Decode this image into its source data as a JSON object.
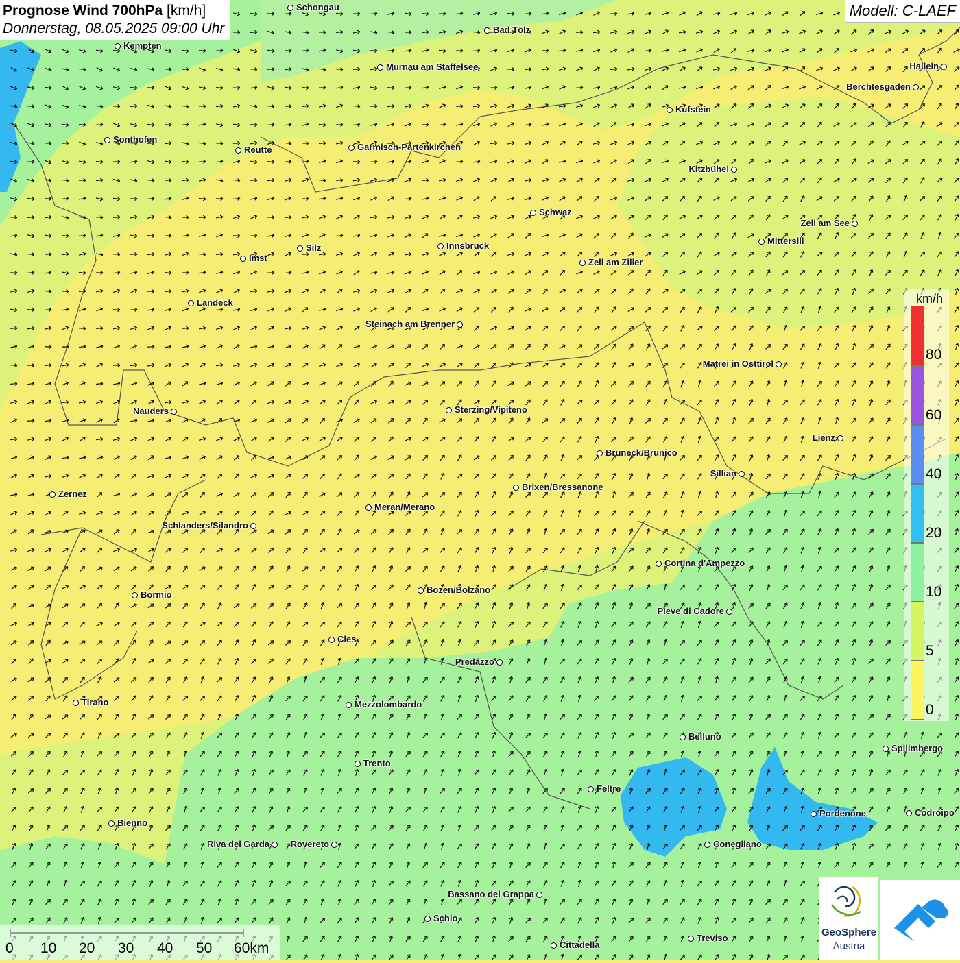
{
  "title": {
    "bold": "Prognose Wind 700hPa",
    "unit": "[km/h]",
    "date": "Donnerstag, 08.05.2025 09:00 Uhr"
  },
  "model": "Modell: C-LAEF",
  "legend": {
    "unit": "km/h",
    "labels": [
      "80",
      "60",
      "40",
      "20",
      "10",
      "5",
      "0"
    ],
    "bands": [
      {
        "range": "80+",
        "color": "#f03030"
      },
      {
        "range": "60-80",
        "color": "#9a55e0"
      },
      {
        "range": "40-60",
        "color": "#5a8ef0"
      },
      {
        "range": "20-40",
        "color": "#33c0f0"
      },
      {
        "range": "10-20",
        "color": "#8ef0a0"
      },
      {
        "range": "5-10",
        "color": "#d4f560"
      },
      {
        "range": "0-5",
        "color": "#fdf560"
      }
    ]
  },
  "scale_bar": {
    "labels": [
      "0",
      "10",
      "20",
      "30",
      "40",
      "50",
      "60km"
    ]
  },
  "logo": {
    "name1": "GeoSphere",
    "name2": "Austria"
  },
  "cities": [
    {
      "name": "Schongau"
    },
    {
      "name": "Bad Tölz"
    },
    {
      "name": "Kempten"
    },
    {
      "name": "Murnau am Staffelsee"
    },
    {
      "name": "Hallein"
    },
    {
      "name": "Berchtesgaden"
    },
    {
      "name": "Kufstein"
    },
    {
      "name": "Sonthofen"
    },
    {
      "name": "Reutte"
    },
    {
      "name": "Garmisch-Partenkirchen"
    },
    {
      "name": "Kitzbühel"
    },
    {
      "name": "Schwaz"
    },
    {
      "name": "Zell am See"
    },
    {
      "name": "Mittersill"
    },
    {
      "name": "Silz"
    },
    {
      "name": "Innsbruck"
    },
    {
      "name": "Imst"
    },
    {
      "name": "Zell am Ziller"
    },
    {
      "name": "Landeck"
    },
    {
      "name": "Steinach am Brenner"
    },
    {
      "name": "Matrei in Osttirol"
    },
    {
      "name": "Nauders"
    },
    {
      "name": "Sterzing/Vipiteno"
    },
    {
      "name": "Lienz"
    },
    {
      "name": "Bruneck/Brunico"
    },
    {
      "name": "Sillian"
    },
    {
      "name": "Zernez"
    },
    {
      "name": "Brixen/Bressanone"
    },
    {
      "name": "Meran/Merano"
    },
    {
      "name": "Schlanders/Silandro"
    },
    {
      "name": "Cortina d'Ampezzo"
    },
    {
      "name": "Bozen/Bolzano"
    },
    {
      "name": "Bormio"
    },
    {
      "name": "Pieve di Cadore"
    },
    {
      "name": "Cles"
    },
    {
      "name": "Predazzo"
    },
    {
      "name": "Tirano"
    },
    {
      "name": "Mezzolombardo"
    },
    {
      "name": "Belluno"
    },
    {
      "name": "Spilimbergo"
    },
    {
      "name": "Trento"
    },
    {
      "name": "Feltre"
    },
    {
      "name": "Bienno"
    },
    {
      "name": "Pordenone"
    },
    {
      "name": "Codroipo"
    },
    {
      "name": "Riva del Garda"
    },
    {
      "name": "Rovereto"
    },
    {
      "name": "Conegliano"
    },
    {
      "name": "Bassano del Grappa"
    },
    {
      "name": "Schio"
    },
    {
      "name": "Treviso"
    },
    {
      "name": "Cittadella"
    }
  ]
}
